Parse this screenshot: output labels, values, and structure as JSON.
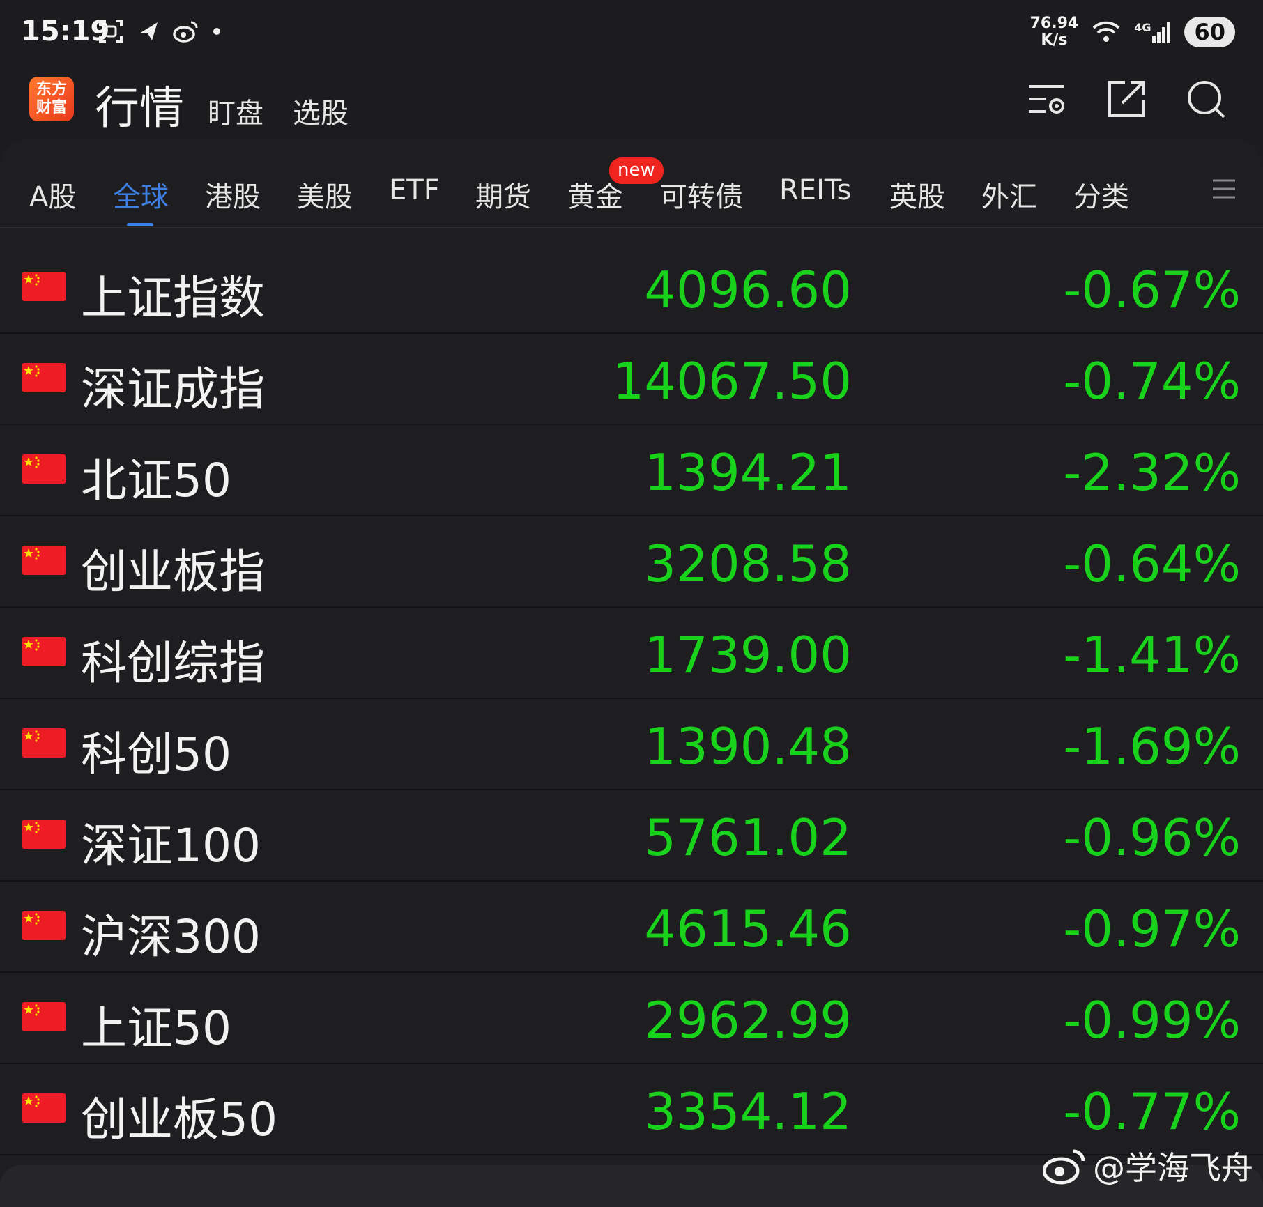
{
  "status_bar": {
    "time": "15:19",
    "speed_value": "76.94",
    "speed_unit": "K/s",
    "network": "4G",
    "battery": "60",
    "icons": [
      "screenshot-icon",
      "paper-plane-icon",
      "weibo-icon",
      "dot-icon",
      "wifi-icon",
      "signal-icon"
    ]
  },
  "header": {
    "logo_line1": "东方",
    "logo_line2": "财富",
    "title": "行情",
    "links": [
      "盯盘",
      "选股"
    ],
    "icons": [
      "list-settings-icon",
      "share-icon",
      "search-icon"
    ]
  },
  "tabs": {
    "items": [
      "A股",
      "全球",
      "港股",
      "美股",
      "ETF",
      "期货",
      "黄金",
      "可转债",
      "REITs",
      "英股",
      "外汇",
      "分类"
    ],
    "active_index": 1,
    "badge": "new",
    "badge_tab_index": 6
  },
  "indices": [
    {
      "name": "上证指数",
      "price": "4096.60",
      "change": "-0.67%"
    },
    {
      "name": "深证成指",
      "price": "14067.50",
      "change": "-0.74%"
    },
    {
      "name": "北证50",
      "price": "1394.21",
      "change": "-2.32%"
    },
    {
      "name": "创业板指",
      "price": "3208.58",
      "change": "-0.64%"
    },
    {
      "name": "科创综指",
      "price": "1739.00",
      "change": "-1.41%"
    },
    {
      "name": "科创50",
      "price": "1390.48",
      "change": "-1.69%"
    },
    {
      "name": "深证100",
      "price": "5761.02",
      "change": "-0.96%"
    },
    {
      "name": "沪深300",
      "price": "4615.46",
      "change": "-0.97%"
    },
    {
      "name": "上证50",
      "price": "2962.99",
      "change": "-0.99%"
    },
    {
      "name": "创业板50",
      "price": "3354.12",
      "change": "-0.77%"
    }
  ],
  "watermark": "@学海飞舟",
  "colors": {
    "background": "#1c1c1e",
    "down_green": "#19d21c",
    "active_tab": "#3d7fe0",
    "badge_red": "#f0251f",
    "flag_red": "#ee1c25",
    "flag_star": "#ffde00"
  }
}
